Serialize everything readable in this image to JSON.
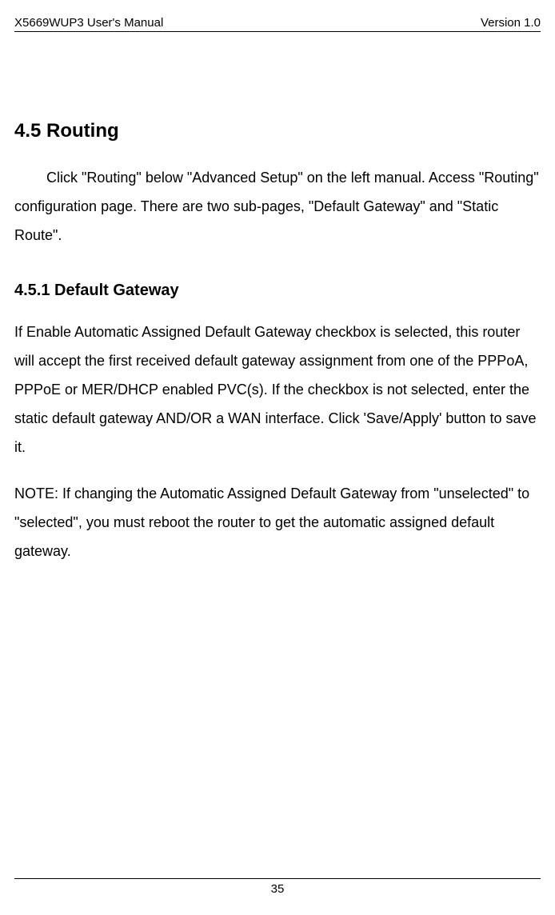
{
  "header": {
    "left": "X5669WUP3 User's Manual",
    "right": "Version 1.0"
  },
  "sections": {
    "routing": {
      "heading": "4.5 Routing",
      "body": "Click \"Routing\" below \"Advanced Setup\" on the left manual. Access \"Routing\" configuration page. There are two sub-pages, \"Default Gateway\" and \"Static Route\"."
    },
    "default_gateway": {
      "heading": "4.5.1 Default Gateway",
      "body1": "If Enable Automatic Assigned Default Gateway checkbox is selected, this router will accept the first received default gateway assignment from one of the PPPoA, PPPoE or MER/DHCP enabled PVC(s). If the checkbox is not selected, enter the static default gateway AND/OR a WAN interface. Click 'Save/Apply' button to save it.",
      "body2": "NOTE: If changing the Automatic Assigned Default Gateway from \"unselected\" to \"selected\", you must reboot the router to get the automatic assigned default gateway."
    }
  },
  "footer": {
    "page": "35"
  }
}
